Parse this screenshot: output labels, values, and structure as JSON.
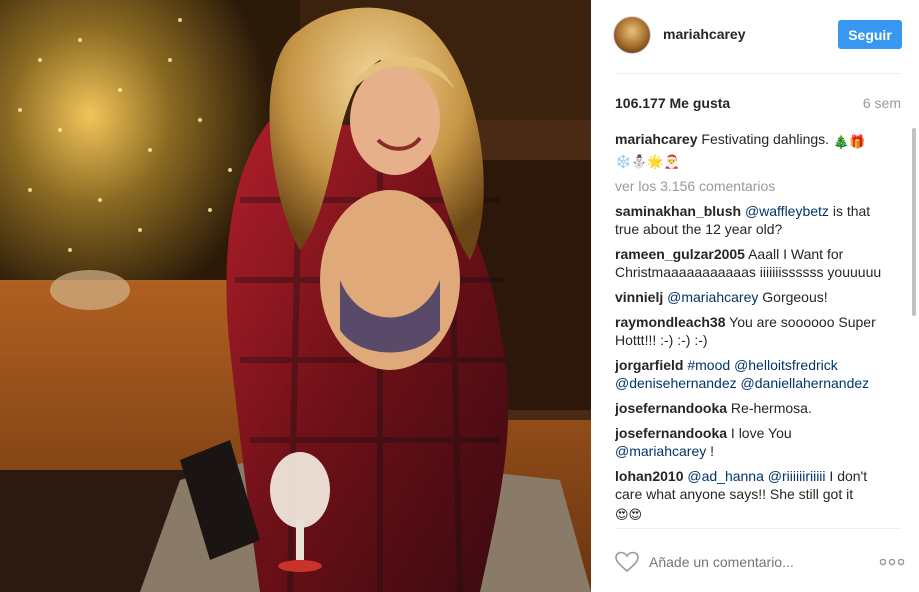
{
  "post": {
    "username": "mariahcarey",
    "follow_label": "Seguir",
    "likes": "106.177 Me gusta",
    "time_ago": "6 sem",
    "caption_user": "mariahcarey",
    "caption_text": "Festivating dahlings.",
    "caption_emoji_1": "🎄🎁",
    "caption_emoji_2": "❄️⛄🌟🎅",
    "view_all": "ver los 3.156 comentarios",
    "add_comment_placeholder": "Añade un comentario..."
  },
  "comments": [
    {
      "user": "saminakhan_blush",
      "mention": "@waffleybetz",
      "text": " is that true about the 12 year old?"
    },
    {
      "user": "rameen_gulzar2005",
      "text": "Aaall I Want for Christmaaaaaaaaaaas iiiiiiissssss youuuuu"
    },
    {
      "user": "vinnielj",
      "mention": "@mariahcarey",
      "text": " Gorgeous!"
    },
    {
      "user": "raymondleach38",
      "text": "You are soooooo Super Hottt!!! :-) :-) :-)"
    },
    {
      "user": "jorgarfield",
      "tag": "#mood",
      "mention": "@helloitsfredrick",
      "mention2": "@denisehernandez",
      "mention3": "@daniellahernandez"
    },
    {
      "user": "josefernandooka",
      "text": "Re-hermosa."
    },
    {
      "user": "josefernandooka",
      "text": "I love You",
      "mention": "@mariahcarey",
      "tail": " !"
    },
    {
      "user": "lohan2010",
      "mention": "@ad_hanna",
      "mention2": "@riiiiiiriiiii",
      "text": " I don't care what anyone says!! She still got it",
      "emoji": "😍😍"
    }
  ],
  "colors": {
    "accent": "#3897f0",
    "mention": "#003569",
    "muted": "#999999"
  }
}
